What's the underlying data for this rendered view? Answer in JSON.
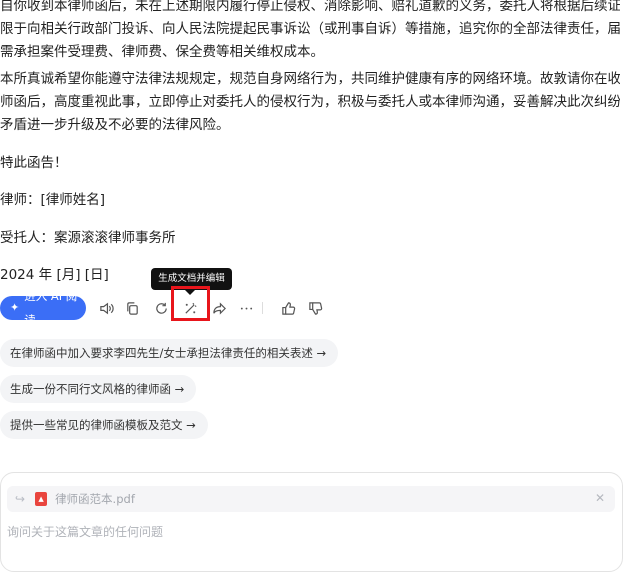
{
  "letter": {
    "paragraph1_lines": [
      "自你收到本律师函后，未在上述期限内履行停止侵权、消除影响、赔礼道歉的义务，委托人将根据后续证据情况，",
      "限于向相关行政部门投诉、向人民法院提起民事诉讼（或刑事自诉）等措施，追究你的全部法律责任，届时你还",
      "需承担案件受理费、律师费、保全费等相关维权成本。"
    ],
    "paragraph2_lines": [
      "本所真诚希望你能遵守法律法规规定，规范自身网络行为，共同维护健康有序的网络环境。故敦请你在收到本律",
      "师函后，高度重视此事，立即停止对委托人的侵权行为，积极与委托人或本律师沟通，妥善解决此次纠纷，避免",
      "矛盾进一步升级及不必要的法律风险。"
    ],
    "closing": "特此函告！",
    "lawyer": "律师：[律师姓名]",
    "client": "受托人：案源滚滚律师事务所",
    "date": "2024 年 [月] [日]"
  },
  "toolbar": {
    "ai_read_label": "进入 AI 阅读",
    "tooltip": "生成文档并编辑",
    "icons": [
      "speaker-icon",
      "copy-icon",
      "regenerate-icon",
      "magic-edit-icon",
      "share-icon",
      "more-icon",
      "thumbs-up-icon",
      "thumbs-down-icon"
    ],
    "accent_color": "#3b6ef6",
    "highlight_color": "#e8151b"
  },
  "suggestions": [
    "在律师函中加入要求李四先生/女士承担法律责任的相关表述 →",
    "生成一份不同行文风格的律师函 →",
    "提供一些常见的律师函模板及范文 →"
  ],
  "composer": {
    "attachment_name": "律师函范本.pdf",
    "placeholder": "询问关于这篇文章的任何问题"
  }
}
